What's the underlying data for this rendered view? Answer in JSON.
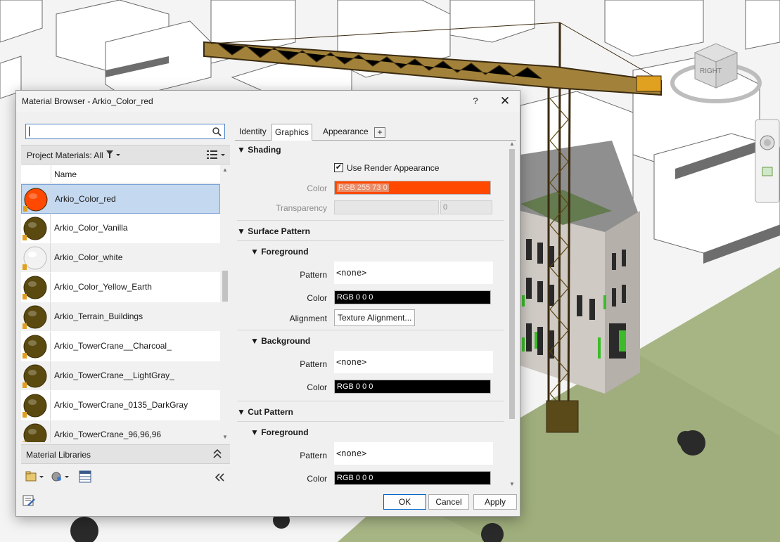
{
  "dialog": {
    "title": "Material Browser - Arkio_Color_red",
    "help": "?",
    "close": "✕"
  },
  "left": {
    "search": {
      "value": "",
      "placeholder": ""
    },
    "project_materials_label": "Project Materials: All",
    "list_header": "Name",
    "materials": [
      {
        "name": "Arkio_Color_red",
        "color": "#ff4900",
        "selected": true
      },
      {
        "name": "Arkio_Color_Vanilla",
        "color": "#5a4a10"
      },
      {
        "name": "Arkio_Color_white",
        "color": "#f2f2f2"
      },
      {
        "name": "Arkio_Color_Yellow_Earth",
        "color": "#5a4a10"
      },
      {
        "name": "Arkio_Terrain_Buildings",
        "color": "#5a4a10"
      },
      {
        "name": "Arkio_TowerCrane__Charcoal_",
        "color": "#5a4a10"
      },
      {
        "name": "Arkio_TowerCrane__LightGray_",
        "color": "#5a4a10"
      },
      {
        "name": "Arkio_TowerCrane_0135_DarkGray",
        "color": "#5a4a10"
      },
      {
        "name": "Arkio_TowerCrane_96,96,96",
        "color": "#5a4a10"
      }
    ],
    "libraries_label": "Material Libraries"
  },
  "tabs": [
    "Identity",
    "Graphics",
    "Appearance"
  ],
  "tab_add": "+",
  "graphics": {
    "shading": {
      "title": "Shading",
      "use_render_label": "Use Render Appearance",
      "use_render_checked": "✔",
      "color_label": "Color",
      "color_value": "RGB 255 73 0",
      "transparency_label": "Transparency",
      "transparency_value": "0"
    },
    "surface_pattern": {
      "title": "Surface Pattern",
      "foreground": {
        "title": "Foreground",
        "pattern_label": "Pattern",
        "pattern_value": "<none>",
        "color_label": "Color",
        "color_value": "RGB 0 0 0",
        "alignment_label": "Alignment",
        "alignment_button": "Texture Alignment..."
      },
      "background": {
        "title": "Background",
        "pattern_label": "Pattern",
        "pattern_value": "<none>",
        "color_label": "Color",
        "color_value": "RGB 0 0 0"
      }
    },
    "cut_pattern": {
      "title": "Cut Pattern",
      "foreground": {
        "title": "Foreground",
        "pattern_label": "Pattern",
        "pattern_value": "<none>",
        "color_label": "Color",
        "color_value": "RGB 0 0 0"
      }
    }
  },
  "footer": {
    "ok": "OK",
    "cancel": "Cancel",
    "apply": "Apply"
  },
  "viewcube": {
    "face_label": "RIGHT"
  }
}
